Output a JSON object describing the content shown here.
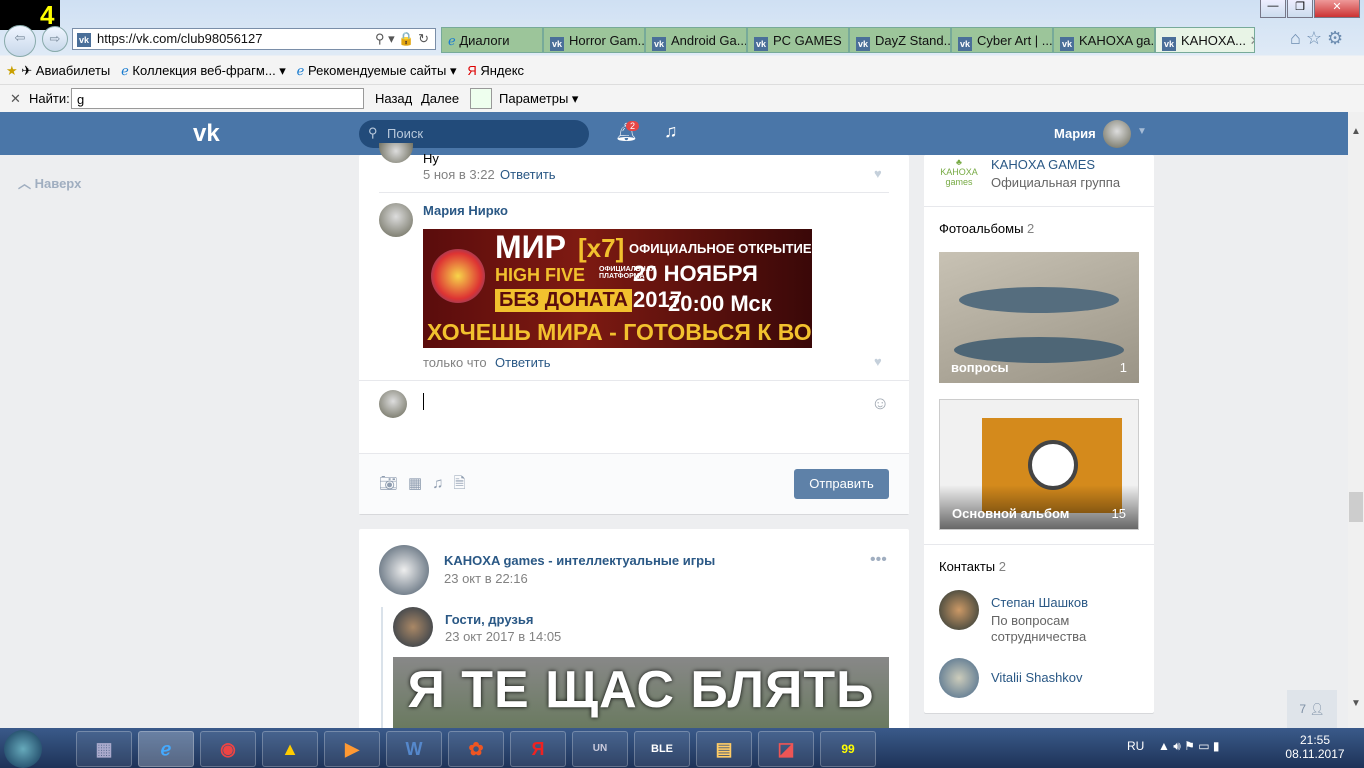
{
  "browser": {
    "overlay_digit": "4",
    "url": "https://vk.com/club98056127",
    "tabs": [
      "Диалоги",
      "Horror Gam...",
      "Android Ga...",
      "PC GAMES",
      "DayZ Stand...",
      "Cyber Art | ...",
      "KAHOXA ga...",
      "KAHOXA..."
    ],
    "favorites": [
      "Авиабилеты",
      "Коллекция веб-фрагм...",
      "Рекомендуемые сайты",
      "Яндекс"
    ],
    "find": {
      "label": "Найти:",
      "value": "g",
      "prev": "Назад",
      "next": "Далее",
      "options": "Параметры"
    }
  },
  "header": {
    "search_placeholder": "Поиск",
    "notif_count": "2",
    "user": "Мария"
  },
  "left": {
    "up": "Наверх"
  },
  "feed": {
    "prev_comment": {
      "text": "Ну",
      "time": "5 ноя в 3:22",
      "reply": "Ответить"
    },
    "comment": {
      "author": "Мария Нирко",
      "time": "только что",
      "reply": "Ответить",
      "banner": {
        "title": "МИР",
        "tag": "[x7]",
        "sub": "HIGH FIVE",
        "platform": "ОФИЦИАЛЬНАЯ ПЛАТФОРМА",
        "opening": "ОФИЦИАЛЬНОЕ ОТКРЫТИЕ",
        "date": "20 НОЯБРЯ 2017",
        "nodonate": "БЕЗ ДОНАТА",
        "time": "20:00 Мск",
        "slogan": "ХОЧЕШЬ МИРА - ГОТОВЬСЯ К ВОЙНЕ"
      }
    },
    "send": "Отправить",
    "post": {
      "author": "KAHOXA games - интеллектуальные игры",
      "time": "23 окт в 22:16",
      "repost_author": "Гости, друзья",
      "repost_time": "23 окт 2017 в 14:05",
      "meme_text": "Я ТЕ ЩАС БЛЯТЬ"
    }
  },
  "right": {
    "group_name": "KAHOXA GAMES",
    "group_desc": "Официальная группа",
    "group_logo": "KAHOXA games",
    "albums_title": "Фотоальбомы",
    "albums_count": "2",
    "albums": [
      {
        "name": "вопросы",
        "count": "1"
      },
      {
        "name": "Основной альбом",
        "count": "15"
      }
    ],
    "contacts_title": "Контакты",
    "contacts_count": "2",
    "contacts": [
      {
        "name": "Степан Шашков",
        "desc": "По вопросам сотрудничества"
      },
      {
        "name": "Vitalii Shashkov"
      }
    ],
    "friends_count": "7"
  },
  "taskbar": {
    "lang": "RU",
    "time": "21:55",
    "date": "08.11.2017"
  }
}
